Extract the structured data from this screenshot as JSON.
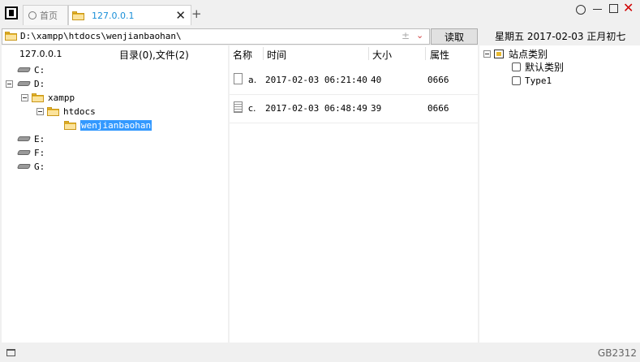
{
  "tabs": [
    {
      "label": "首页"
    },
    {
      "label": "127.0.0.1"
    }
  ],
  "address": {
    "path": "D:\\xampp\\htdocs\\wenjianbaohan\\",
    "plus_glyph": "±"
  },
  "read_button": "读取",
  "date_line": "星期五  2017-02-03  正月初七",
  "left_header": {
    "host": "127.0.0.1",
    "summary": "目录(0),文件(2)"
  },
  "tree": {
    "c": "C:",
    "d": "D:",
    "xampp": "xampp",
    "htdocs": "htdocs",
    "wenjianbaohan": "wenjianbaohan",
    "e": "E:",
    "f": "F:",
    "g": "G:"
  },
  "columns": {
    "name": "名称",
    "time": "时间",
    "size": "大小",
    "attr": "属性"
  },
  "files": [
    {
      "name": "a.",
      "time": "2017-02-03 06:21:40",
      "size": "40",
      "attr": "0666"
    },
    {
      "name": "c.",
      "time": "2017-02-03 06:48:49",
      "size": "39",
      "attr": "0666"
    }
  ],
  "categories": {
    "root": "站点类别",
    "items": [
      "默认类别",
      "Type1"
    ]
  },
  "status": {
    "encoding": "GB2312"
  },
  "colors": {
    "accent": "#1a8fd8",
    "selection": "#3399ff",
    "close_red": "#d00000"
  }
}
